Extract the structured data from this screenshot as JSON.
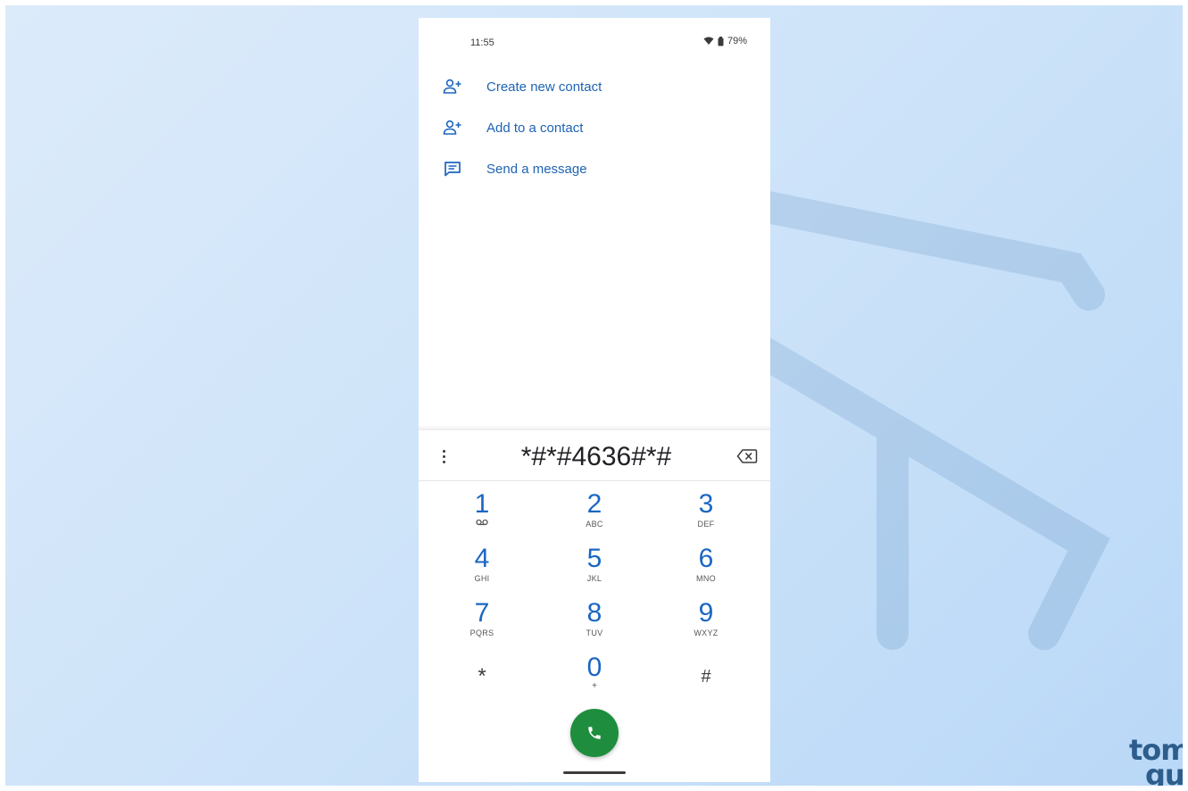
{
  "status_bar": {
    "time": "11:55",
    "battery": "79%"
  },
  "menu": {
    "items": [
      {
        "label": "Create new contact",
        "icon": "person-add-icon"
      },
      {
        "label": "Add to a contact",
        "icon": "person-add-icon"
      },
      {
        "label": "Send a message",
        "icon": "message-icon"
      }
    ]
  },
  "dialer": {
    "number": "*#*#4636#*#",
    "keys": [
      {
        "digit": "1",
        "letters": "voicemail"
      },
      {
        "digit": "2",
        "letters": "ABC"
      },
      {
        "digit": "3",
        "letters": "DEF"
      },
      {
        "digit": "4",
        "letters": "GHI"
      },
      {
        "digit": "5",
        "letters": "JKL"
      },
      {
        "digit": "6",
        "letters": "MNO"
      },
      {
        "digit": "7",
        "letters": "PQRS"
      },
      {
        "digit": "8",
        "letters": "TUV"
      },
      {
        "digit": "9",
        "letters": "WXYZ"
      },
      {
        "digit": "*",
        "letters": ""
      },
      {
        "digit": "0",
        "letters": "+"
      },
      {
        "digit": "#",
        "letters": ""
      }
    ]
  },
  "brand": {
    "line1": "tom",
    "line2": "gu"
  },
  "colors": {
    "accent": "#1a66c2",
    "call_button": "#1e8e3e",
    "background": "#cfe4f9"
  }
}
